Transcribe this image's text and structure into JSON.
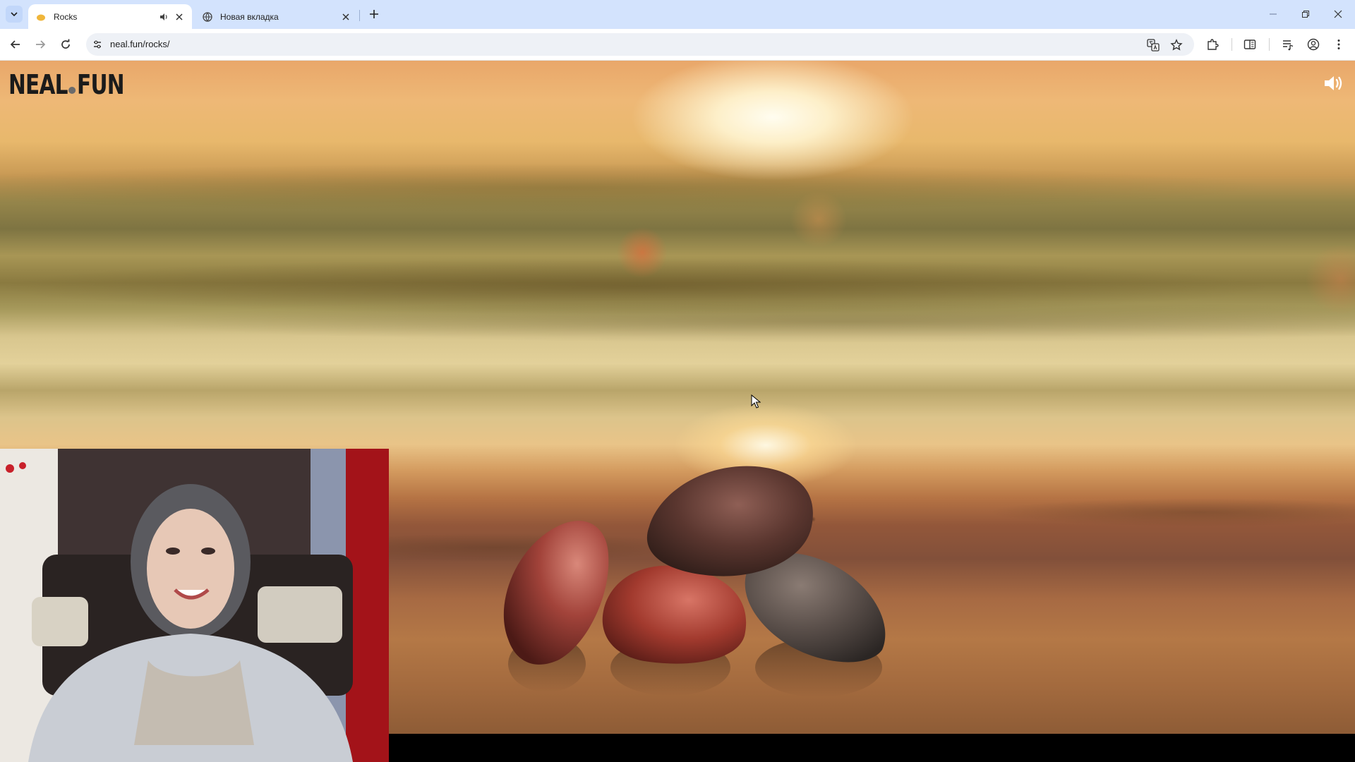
{
  "browser": {
    "tabs": [
      {
        "title": "Rocks",
        "active": true,
        "audio": true
      },
      {
        "title": "Новая вкладка",
        "active": false,
        "audio": false
      }
    ],
    "address": "neal.fun/rocks/"
  },
  "page": {
    "logo_left": "NEAL",
    "logo_right": "FUN"
  },
  "colors": {
    "tabstrip": "#d3e3fd",
    "accent": "#0b57d0"
  },
  "icons": {
    "sound": "speaker-icon",
    "back": "arrow-left-icon",
    "forward": "arrow-right-icon",
    "reload": "reload-icon",
    "translate": "translate-icon",
    "bookmark": "star-icon",
    "extensions": "puzzle-icon",
    "reading_list": "side-panel-icon",
    "media": "media-queue-icon",
    "profile": "profile-icon",
    "menu": "kebab-menu-icon"
  }
}
